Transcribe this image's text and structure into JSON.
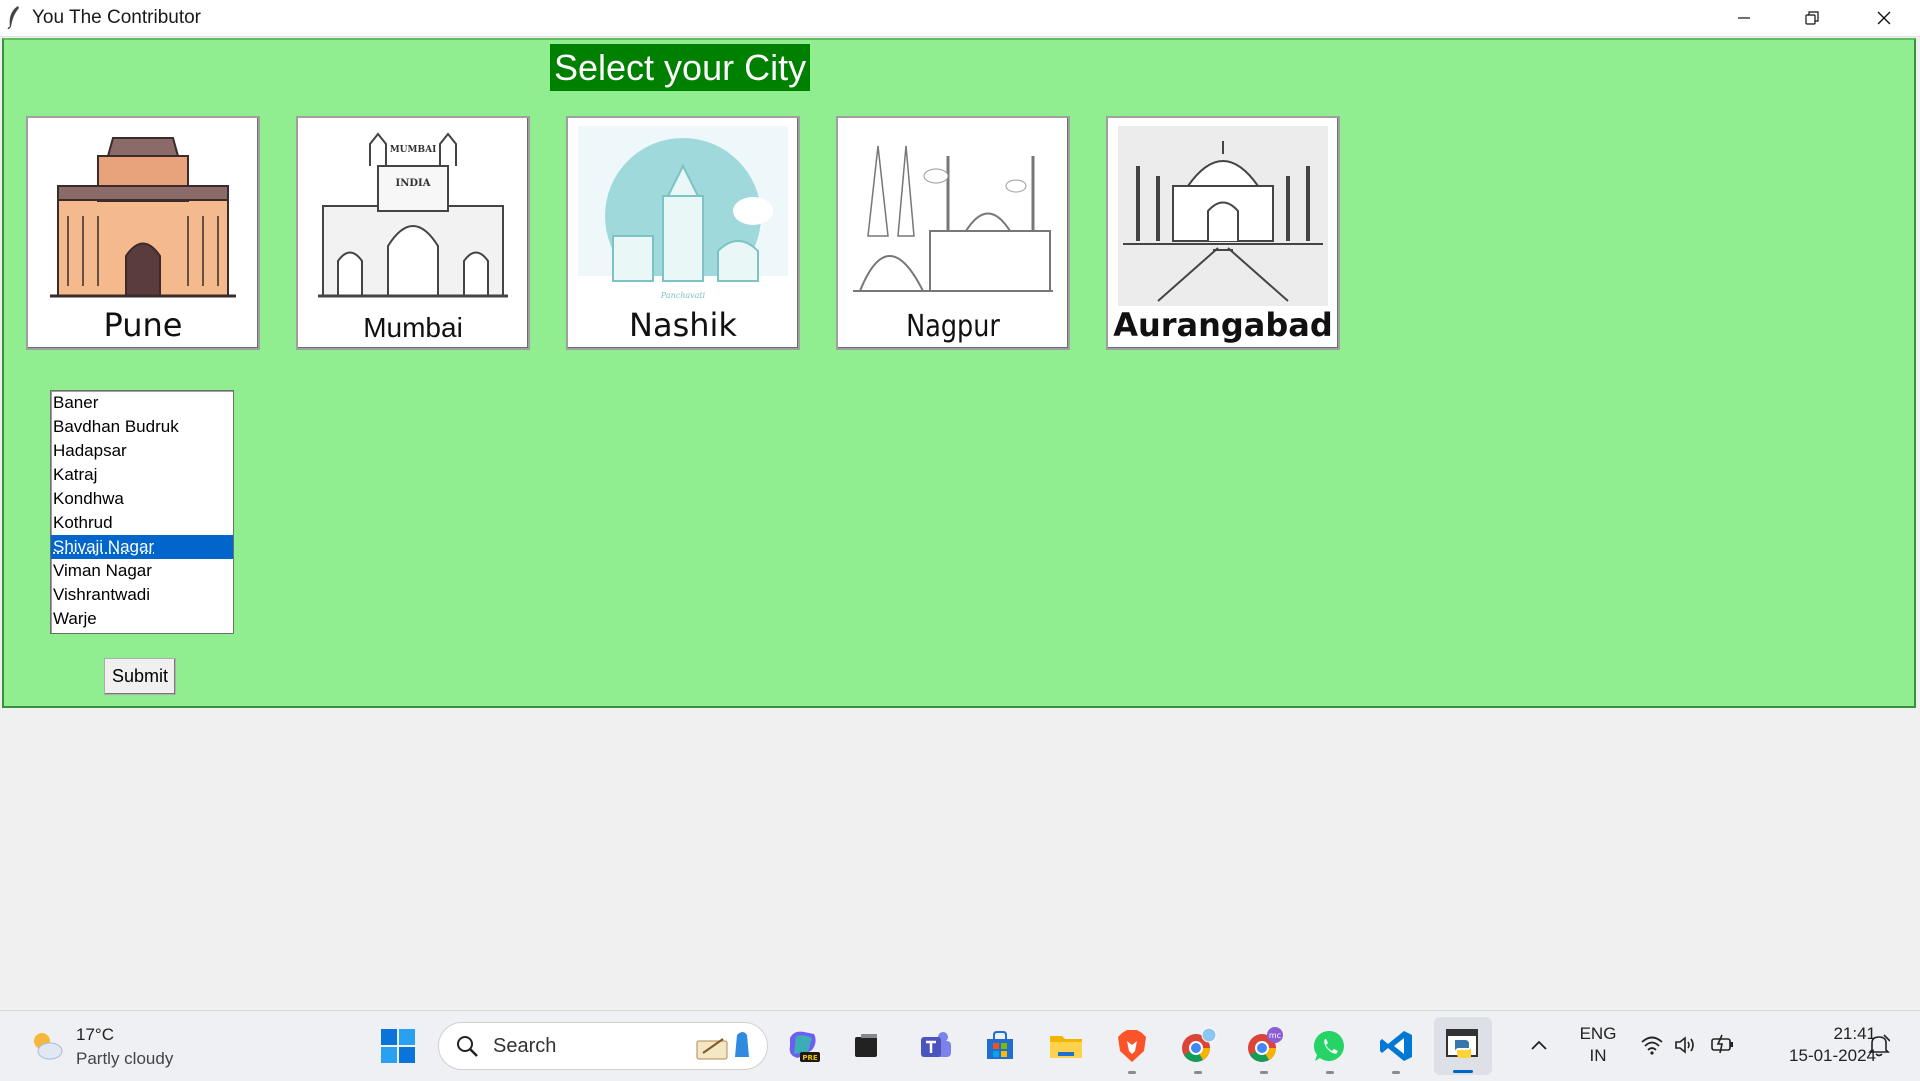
{
  "window": {
    "title": "You The Contributor"
  },
  "heading": "Select your City",
  "cities": [
    {
      "label": "Pune"
    },
    {
      "label": "Mumbai"
    },
    {
      "label": "Nashik"
    },
    {
      "label": "Nagpur"
    },
    {
      "label": "Aurangabad"
    }
  ],
  "city_art_text": {
    "mumbai_sign": "MUMBAI",
    "india_sign": "INDIA",
    "nashik_caption": "Panchavati"
  },
  "localities": {
    "items": [
      "Baner",
      "Bavdhan Budruk",
      "Hadapsar",
      "Katraj",
      "Kondhwa",
      "Kothrud",
      "Shivaji Nagar",
      "Viman Nagar",
      "Vishrantwadi",
      "Warje"
    ],
    "selected": "Shivaji Nagar"
  },
  "submit_label": "Submit",
  "taskbar": {
    "weather_temp": "17°C",
    "weather_desc": "Partly cloudy",
    "search_placeholder": "Search",
    "copilot_badge": "PRE",
    "chrome_badge": "mc",
    "lang_line1": "ENG",
    "lang_line2": "IN",
    "time": "21:41",
    "date": "15-01-2024"
  },
  "colors": {
    "background": "#90ee90",
    "heading_bg": "#008000",
    "selection": "#0066cc"
  }
}
